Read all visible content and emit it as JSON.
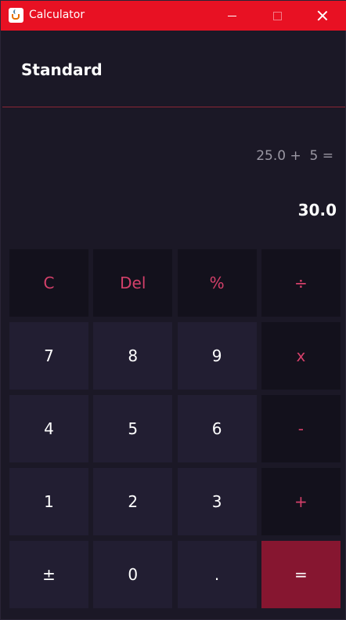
{
  "window": {
    "title": "Calculator",
    "icon": "java-cup-icon",
    "controls": [
      "minimize-icon",
      "maximize-icon",
      "close-icon"
    ],
    "accent": "#e81123"
  },
  "mode": {
    "title": "Standard"
  },
  "display": {
    "expression": "25.0 +  5 =",
    "result": "30.0"
  },
  "keys": [
    {
      "label": "C",
      "type": "func"
    },
    {
      "label": "Del",
      "type": "func"
    },
    {
      "label": "%",
      "type": "func"
    },
    {
      "label": "÷",
      "type": "func"
    },
    {
      "label": "7",
      "type": "num"
    },
    {
      "label": "8",
      "type": "num"
    },
    {
      "label": "9",
      "type": "num"
    },
    {
      "label": "x",
      "type": "func"
    },
    {
      "label": "4",
      "type": "num"
    },
    {
      "label": "5",
      "type": "num"
    },
    {
      "label": "6",
      "type": "num"
    },
    {
      "label": "-",
      "type": "func"
    },
    {
      "label": "1",
      "type": "num"
    },
    {
      "label": "2",
      "type": "num"
    },
    {
      "label": "3",
      "type": "num"
    },
    {
      "label": "+",
      "type": "func"
    },
    {
      "label": "±",
      "type": "num"
    },
    {
      "label": "0",
      "type": "num"
    },
    {
      "label": ".",
      "type": "num"
    },
    {
      "label": "=",
      "type": "equals"
    }
  ],
  "colors": {
    "background": "#1b1826",
    "operator_text": "#d4406a",
    "operator_key": "#13111c",
    "number_key": "#221e32",
    "equals_key": "#861630"
  }
}
